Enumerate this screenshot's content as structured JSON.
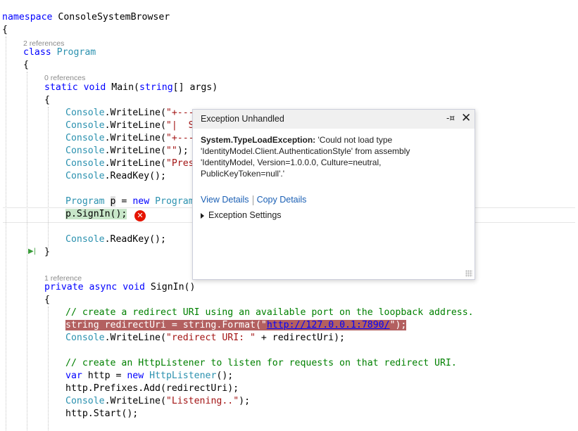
{
  "code": {
    "line1": {
      "kw": "namespace",
      "rest": " ConsoleSystemBrowser"
    },
    "line2": "{",
    "lens_program": "2 references",
    "line3": {
      "kw": "class",
      "ty": "Program"
    },
    "line4": "{",
    "lens_main": "0 references",
    "line5": {
      "kw1": "static",
      "kw2": "void",
      "name": " Main(",
      "kw3": "string",
      "rest": "[] args)"
    },
    "line6": "{",
    "line7": {
      "ty": "Console",
      "m": ".WriteLine(",
      "st": "\"+----"
    },
    "line8": {
      "ty": "Console",
      "m": ".WriteLine(",
      "st": "\"|  Si"
    },
    "line9": {
      "ty": "Console",
      "m": ".WriteLine(",
      "st": "\"+----"
    },
    "line10": {
      "ty": "Console",
      "m": ".WriteLine(",
      "st": "\"\"",
      "end": ");"
    },
    "line11": {
      "ty": "Console",
      "m": ".WriteLine(",
      "st": "\"Press"
    },
    "line12": {
      "ty": "Console",
      "m": ".ReadKey();"
    },
    "line13": {
      "ty1": "Program",
      "sp": " ",
      "var": "p",
      "eq": " = ",
      "kw": "new",
      "ty2": " Program("
    },
    "line14": "p.SignIn();",
    "line15": {
      "ty": "Console",
      "m": ".ReadKey();"
    },
    "line16": "}",
    "lens_signin": "1 reference",
    "line17": {
      "kw1": "private",
      "kw2": "async",
      "kw3": "void",
      "rest": " SignIn()"
    },
    "line18": "{",
    "line19": "// create a redirect URI using an available port on the loopback address.",
    "line20": {
      "kw": "string",
      "a": " redirectUri = ",
      "kw2": "string",
      "b": ".Format(",
      "q1": "\"",
      "url": "http://127.0.0.1:7890/",
      "q2": "\"",
      "end": ");"
    },
    "line21": {
      "ty": "Console",
      "m": ".WriteLine(",
      "st": "\"redirect URI: \"",
      "end": " + redirectUri);"
    },
    "line22": "// create an HttpListener to listen for requests on that redirect URI.",
    "line23": {
      "kw": "var",
      "a": " http = ",
      "kw2": "new",
      "ty": " HttpListener",
      "end": "();"
    },
    "line24": "http.Prefixes.Add(redirectUri);",
    "line25": {
      "ty": "Console",
      "m": ".WriteLine(",
      "st": "\"Listening..\"",
      "end": ");"
    },
    "line26": "http.Start();"
  },
  "exception_popup": {
    "title": "Exception Unhandled",
    "pin_icon": "pin-icon",
    "close_icon": "close-icon",
    "exception_type": "System.TypeLoadException:",
    "message": " 'Could not load type 'IdentityModel.Client.AuthenticationStyle' from assembly 'IdentityModel, Version=1.0.0.0, Culture=neutral, PublicKeyToken=null'.'",
    "view_details": "View Details",
    "copy_details": "Copy Details",
    "settings_label": "Exception Settings"
  },
  "colors": {
    "keyword": "#0000ff",
    "type": "#2b91af",
    "string": "#a31515",
    "comment": "#008000",
    "error_line": "#b36060",
    "error_icon": "#e51400"
  }
}
